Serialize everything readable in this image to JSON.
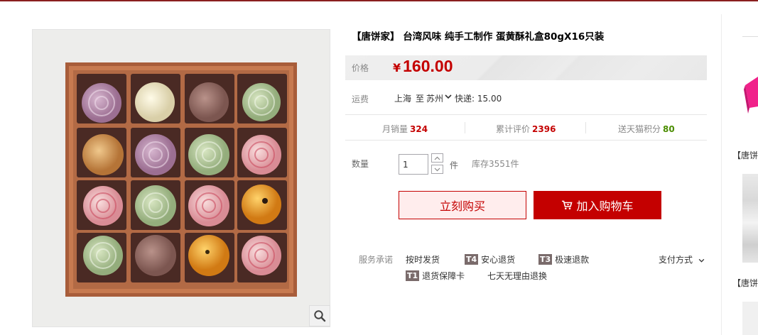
{
  "product": {
    "title": "【唐饼家】 台湾风味 纯手工制作 蛋黄酥礼盒80gX16只装",
    "image_icon": "mooncake-gift-box-image",
    "zoom_icon": "magnifier-icon"
  },
  "price": {
    "label": "价格",
    "currency": "¥",
    "value": "160.00",
    "color": "#c40000"
  },
  "shipping": {
    "label": "运费",
    "from": "上海",
    "to_word": "至",
    "destination": "苏州",
    "fee": "快递: 15.00"
  },
  "stats": {
    "monthly_sales_label": "月销量",
    "monthly_sales": "324",
    "reviews_label": "累计评价",
    "reviews": "2396",
    "points_label": "送天猫积分",
    "points": "80"
  },
  "quantity": {
    "label": "数量",
    "value": "1",
    "unit": "件",
    "stock": "库存3551件"
  },
  "buttons": {
    "buy_now": "立刻购买",
    "add_to_cart": "加入购物车"
  },
  "services": {
    "label": "服务承诺",
    "items": [
      {
        "tag": "",
        "text": "按时发货"
      },
      {
        "tag": "T4",
        "text": "安心退货"
      },
      {
        "tag": "T3",
        "text": "极速退款"
      },
      {
        "tag": "T1",
        "text": "退货保障卡"
      },
      {
        "tag": "",
        "text": "七天无理由退换"
      }
    ],
    "payment": "支付方式"
  },
  "sidebar": {
    "caption1": "【唐饼家",
    "caption2": "【唐饼家"
  },
  "colors": {
    "accent": "#c40000",
    "points_green": "#4b8d00",
    "tag_bg": "#7a6b6b"
  }
}
